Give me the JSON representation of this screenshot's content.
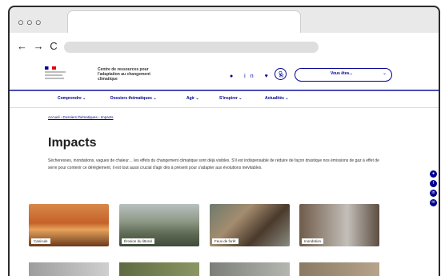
{
  "browser": {
    "window_controls": "○○○",
    "nav_arrows": "← → C"
  },
  "site": {
    "name": "Centre de ressources pour l'adaptation au changement climatique",
    "social_icons": "● in ♥ ✉",
    "search_icon": "search-icon",
    "search_label": "Vous êtes...",
    "search_chevron": "⌄"
  },
  "nav": {
    "items": [
      "Comprendre ⌄",
      "Dossiers thématiques ⌄",
      "Agir ⌄",
      "S'inspirer ⌄",
      "Actualités ⌄"
    ]
  },
  "breadcrumb": "Accueil › Dossiers thématiques › Impacts",
  "page": {
    "title": "Impacts",
    "intro": "Sécheresses, inondations, vagues de chaleur… les effets du changement climatique sont déjà visibles. S'il est indispensable de réduire de façon drastique nos émissions de gaz à effet de serre pour contenir ce dérèglement, il est tout aussi crucial d'agir dès à présent pour s'adapter aux évolutions inévitables."
  },
  "share": [
    "●",
    "f",
    "in",
    "✉"
  ],
  "cards": [
    {
      "label": "Canicule"
    },
    {
      "label": "Érosion du littoral"
    },
    {
      "label": "Feux de forêt"
    },
    {
      "label": "Inondation"
    }
  ],
  "colors": {
    "accent": "#000091",
    "border": "#2b2b2b"
  }
}
